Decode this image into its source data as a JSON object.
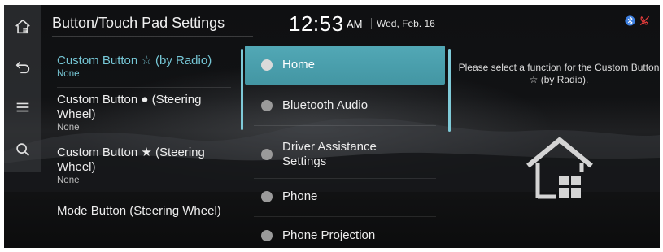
{
  "header": {
    "title": "Button/Touch Pad Settings",
    "time": "12:53",
    "ampm": "AM",
    "date": "Wed, Feb. 16"
  },
  "rail": [
    {
      "icon": "home-icon"
    },
    {
      "icon": "back-icon"
    },
    {
      "icon": "menu-icon"
    },
    {
      "icon": "search-icon"
    }
  ],
  "status_icons": [
    "bluetooth-icon",
    "phone-muted-icon"
  ],
  "settings": [
    {
      "label": "Custom Button ☆ (by Radio)",
      "value": "None",
      "selected": true
    },
    {
      "label": "Custom Button ● (Steering Wheel)",
      "value": "None",
      "selected": false
    },
    {
      "label": "Custom Button ★ (Steering Wheel)",
      "value": "None",
      "selected": false
    },
    {
      "label": "Mode Button (Steering Wheel)",
      "value": "",
      "selected": false
    }
  ],
  "options": [
    {
      "label": "Home",
      "active": true
    },
    {
      "label": "Bluetooth Audio",
      "active": false
    },
    {
      "label": "Driver Assistance Settings",
      "active": false
    },
    {
      "label": "Phone",
      "active": false
    },
    {
      "label": "Phone Projection",
      "active": false
    }
  ],
  "info_text": "Please select a function for the Custom Button ☆ (by Radio).",
  "colors": {
    "accent": "#4aa0ad",
    "selected_text": "#76c7d6",
    "background": "#111214"
  }
}
